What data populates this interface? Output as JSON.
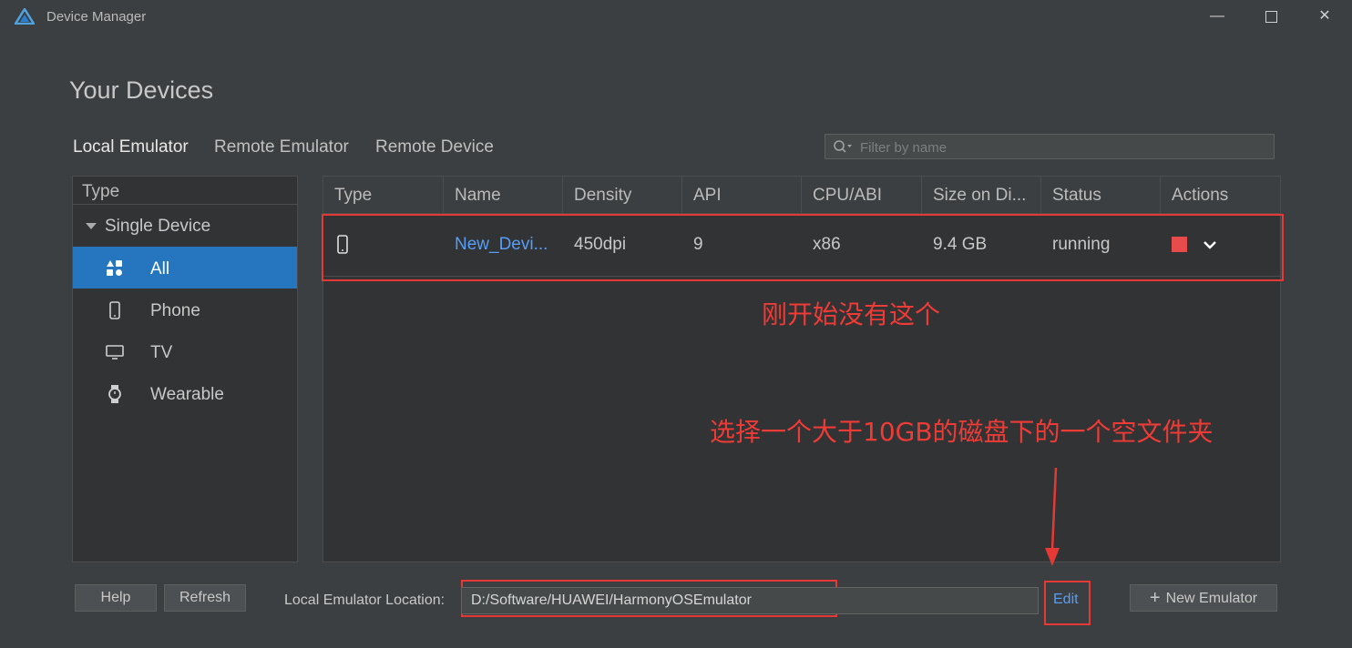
{
  "window": {
    "title": "Device Manager",
    "controls": {
      "minimize": "—",
      "maximize": "",
      "close": "✕"
    }
  },
  "page_title": "Your Devices",
  "tabs": [
    {
      "label": "Local Emulator",
      "active": true
    },
    {
      "label": "Remote Emulator",
      "active": false
    },
    {
      "label": "Remote Device",
      "active": false
    }
  ],
  "search": {
    "placeholder": "Filter by name",
    "value": ""
  },
  "sidebar": {
    "header": "Type",
    "group": "Single Device",
    "items": [
      {
        "label": "All",
        "icon": "shapes-icon",
        "active": true
      },
      {
        "label": "Phone",
        "icon": "phone-icon",
        "active": false
      },
      {
        "label": "TV",
        "icon": "tv-icon",
        "active": false
      },
      {
        "label": "Wearable",
        "icon": "watch-icon",
        "active": false
      }
    ]
  },
  "table": {
    "columns": [
      "Type",
      "Name",
      "Density",
      "API",
      "CPU/ABI",
      "Size on Di...",
      "Status",
      "Actions"
    ],
    "rows": [
      {
        "type_icon": "phone-icon",
        "name": "New_Devi...",
        "density": "450dpi",
        "api": "9",
        "cpu": "x86",
        "size": "9.4 GB",
        "status": "running"
      }
    ]
  },
  "annotations": {
    "row_note": "刚开始没有这个",
    "location_note": "选择一个大于10GB的磁盘下的一个空文件夹"
  },
  "footer": {
    "help_label": "Help",
    "refresh_label": "Refresh",
    "location_label": "Local Emulator Location:",
    "location_value": "D:/Software/HUAWEI/HarmonyOSEmulator",
    "edit_label": "Edit",
    "new_emulator_label": "New Emulator"
  },
  "colors": {
    "background": "#3c3f41",
    "accent": "#2675bf",
    "link": "#589df6",
    "annotation": "#e53935",
    "stop": "#e74b4b"
  }
}
